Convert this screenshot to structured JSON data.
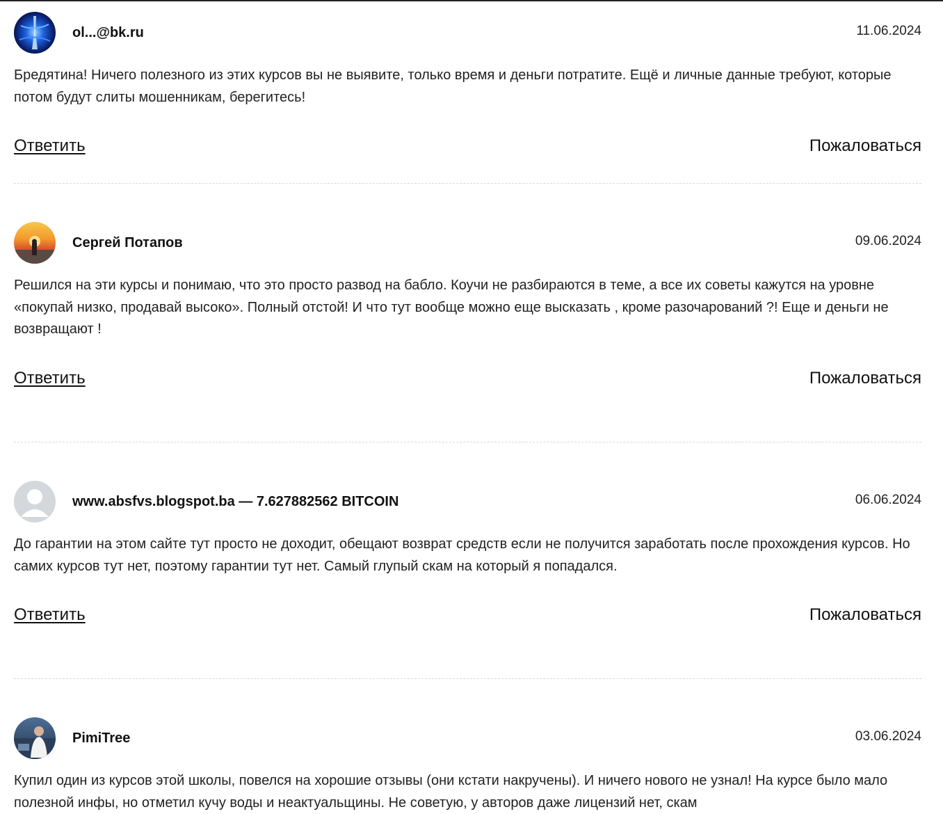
{
  "reviews": [
    {
      "author": "ol...@bk.ru",
      "date": "11.06.2024",
      "text": "Бредятина! Ничего полезного из этих курсов вы не выявите, только время и деньги потратите. Ещё и личные данные требуют, которые потом будут слиты мошенникам, берегитесь!",
      "avatar_icon": "blue-abstract-avatar"
    },
    {
      "author": "Сергей Потапов",
      "date": "09.06.2024",
      "text": "Решился на эти курсы и понимаю, что это просто развод на бабло. Коучи не разбираются в теме, а все их советы кажутся на уровне «покупай низко, продавай высоко». Полный отстой! И что тут вообще можно еще высказать , кроме разочарований ?! Еще и деньги не возвращают !",
      "avatar_icon": "sunset-photo-avatar"
    },
    {
      "author": "www.absfvs.blogspot.ba — 7.627882562 BITCOIN",
      "date": "06.06.2024",
      "text": "До гарантии на этом сайте тут просто не доходит, обещают возврат средств если не получится заработать после прохождения курсов. Но самих курсов тут нет, поэтому гарантии тут нет. Самый глупый скам на который я попадался.",
      "avatar_icon": "default-user-avatar"
    },
    {
      "author": "PimiTree",
      "date": "03.06.2024",
      "text": "Купил один из курсов этой школы, повелся на хорошие отзывы (они кстати накручены). И ничего нового не узнал! На курсе было мало полезной инфы, но отметил кучу воды и неактуальщины. Не советую, у авторов даже лицензий нет, скам",
      "avatar_icon": "man-photo-avatar"
    }
  ],
  "actions": {
    "reply_label": "Ответить",
    "complain_label": "Пожаловаться"
  }
}
